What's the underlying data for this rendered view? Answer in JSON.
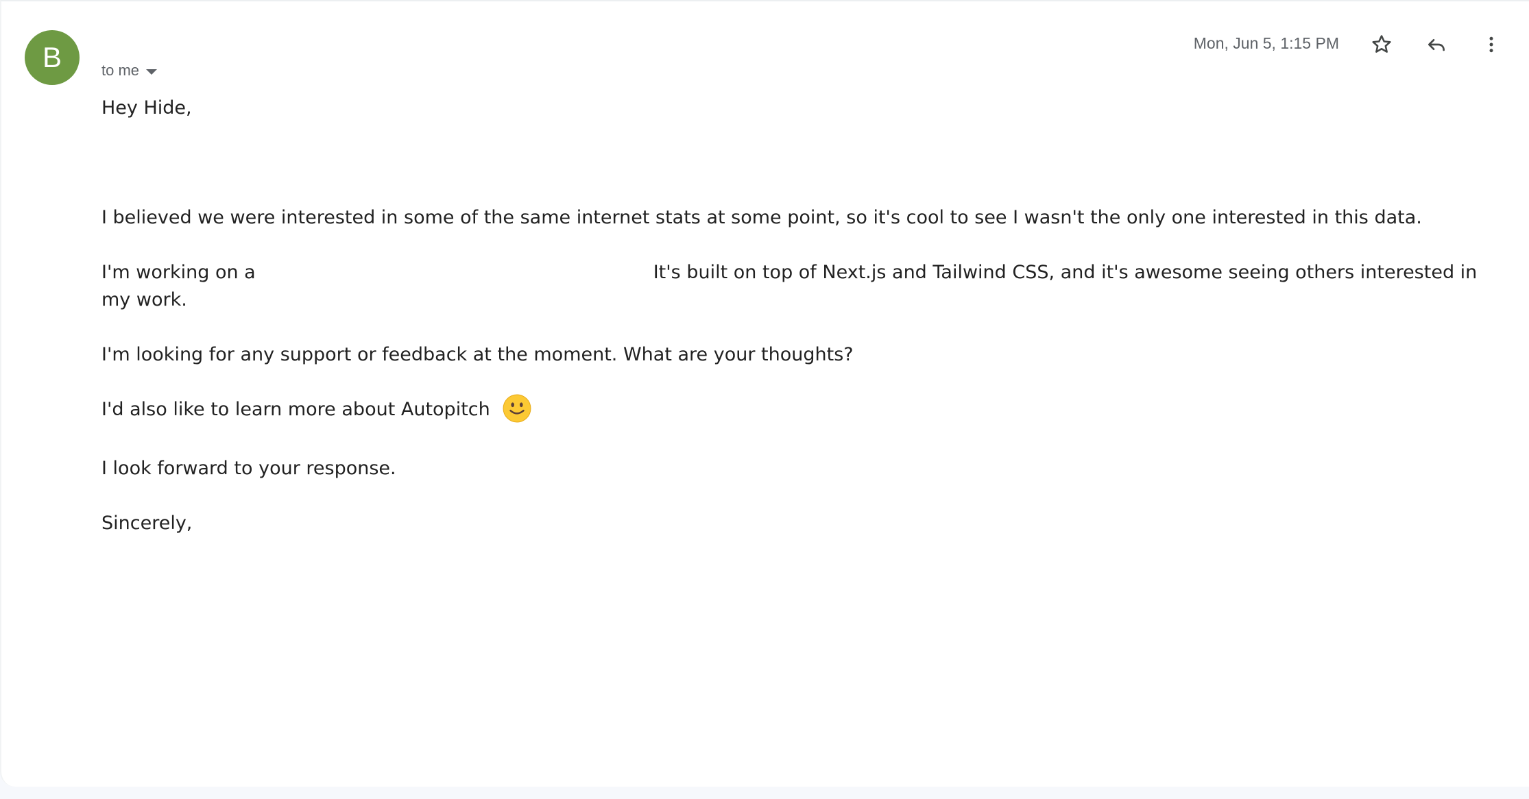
{
  "message": {
    "sender_initial": "B",
    "recipients_label": "to me",
    "date": "Mon, Jun 5, 1:15 PM",
    "body": {
      "greeting": "Hey Hide,",
      "paragraph_1": "I believed we were interested in some of the same internet stats at some point, so it's cool to see I wasn't the only one interested in this data.",
      "paragraph_2_start": "I'm working on a",
      "paragraph_2_end": "It's built on top of Next.js and Tailwind CSS, and it's awesome seeing others interested in my work.",
      "paragraph_3": "I'm looking for any support or feedback at the moment. What are your thoughts?",
      "paragraph_4": "I'd also like to learn more about Autopitch",
      "paragraph_5": "I look forward to your response.",
      "closing": "Sincerely,"
    }
  },
  "icons": {
    "avatar_color": "#6e9a43",
    "star": "star-icon",
    "reply": "reply-icon",
    "more": "more-vert-icon",
    "emoji": "smiling-face-emoji"
  }
}
